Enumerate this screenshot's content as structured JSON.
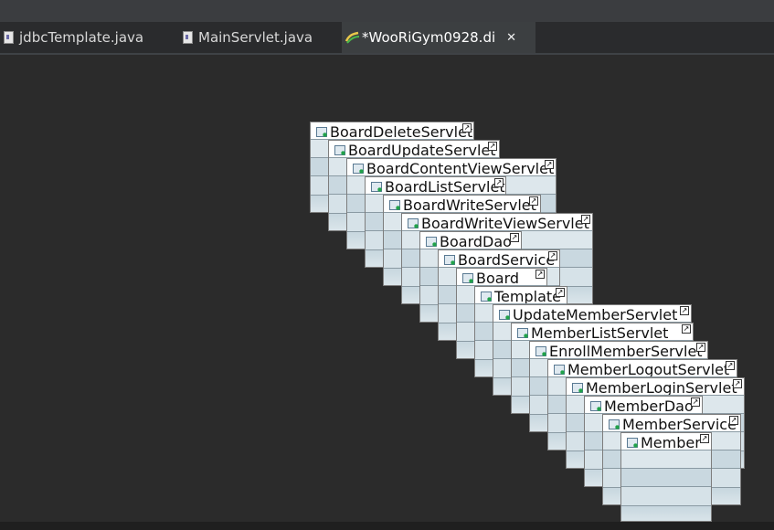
{
  "tabs": [
    {
      "label": "jdbcTemplate.java",
      "active": false
    },
    {
      "label": "MainServlet.java",
      "active": false
    },
    {
      "label": "*WooRiGym0928.di",
      "active": true
    }
  ],
  "close_glyph": "✕",
  "nodes": [
    "BoardDeleteServlet",
    "BoardUpdateServlet",
    "BoardContentViewServlet",
    "BoardListServlet",
    "BoardWriteServlet",
    "BoardWriteViewServlet",
    "BoardDao",
    "BoardService",
    "Board",
    "Template",
    "UpdateMemberServlet",
    "MemberListServlet",
    "EnrollMemberServlet",
    "MemberLogoutServlet",
    "MemberLoginServlet",
    "MemberDao",
    "MemberService",
    "Member"
  ],
  "icons": {
    "file": "java-file-icon",
    "diagram": "uml-diagram-icon",
    "class": "class-icon",
    "shortcut": "shortcut-arrow-icon"
  }
}
